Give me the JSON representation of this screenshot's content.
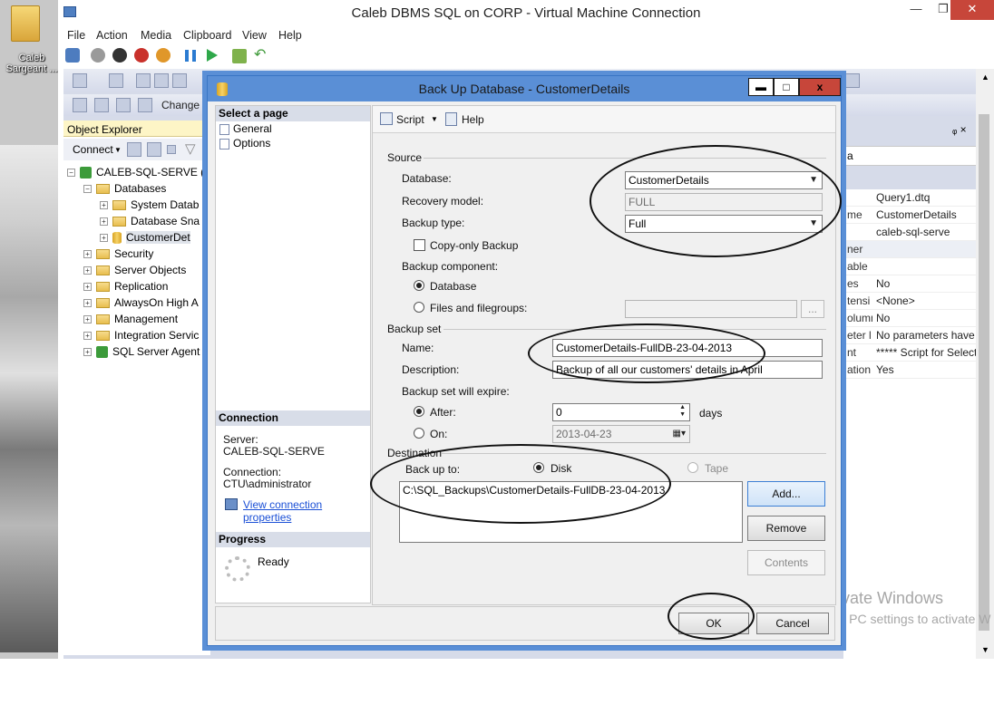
{
  "desktop": {
    "icon_label": "Caleb Sargeant ..."
  },
  "vm_window": {
    "title": "Caleb DBMS SQL on CORP - Virtual Machine Connection",
    "menu": [
      "File",
      "Action",
      "Media",
      "Clipboard",
      "View",
      "Help"
    ]
  },
  "ssms": {
    "change_label": "Change T",
    "object_explorer": {
      "title": "Object Explorer",
      "connect_label": "Connect",
      "tree": [
        {
          "label": "CALEB-SQL-SERVE (S",
          "level": 0,
          "icon": "server-icon",
          "expander": "−"
        },
        {
          "label": "Databases",
          "level": 1,
          "icon": "folder-icon",
          "expander": "−"
        },
        {
          "label": "System Datab",
          "level": 2,
          "icon": "folder-icon",
          "expander": "+"
        },
        {
          "label": "Database Sna",
          "level": 2,
          "icon": "folder-icon",
          "expander": "+"
        },
        {
          "label": "CustomerDet",
          "level": 2,
          "icon": "database-icon",
          "expander": "+"
        },
        {
          "label": "Security",
          "level": 1,
          "icon": "folder-icon",
          "expander": "+"
        },
        {
          "label": "Server Objects",
          "level": 1,
          "icon": "folder-icon",
          "expander": "+"
        },
        {
          "label": "Replication",
          "level": 1,
          "icon": "folder-icon",
          "expander": "+"
        },
        {
          "label": "AlwaysOn High A",
          "level": 1,
          "icon": "folder-icon",
          "expander": "+"
        },
        {
          "label": "Management",
          "level": 1,
          "icon": "folder-icon",
          "expander": "+"
        },
        {
          "label": "Integration Servic",
          "level": 1,
          "icon": "folder-icon",
          "expander": "+"
        },
        {
          "label": "SQL Server Agent",
          "level": 1,
          "icon": "agent-icon",
          "expander": "+"
        }
      ]
    },
    "properties": {
      "pane_pin": "ᵩ ×",
      "partial_label": "a",
      "rows": [
        {
          "k": "",
          "v": "Query1.dtq"
        },
        {
          "k": "me",
          "v": "CustomerDetails"
        },
        {
          "k": "",
          "v": "caleb-sql-serve"
        },
        {
          "k": "ner",
          "v": ""
        },
        {
          "k": "able",
          "v": ""
        },
        {
          "k": "es",
          "v": "No"
        },
        {
          "k": "tensi",
          "v": "<None>"
        },
        {
          "k": "olumn",
          "v": "No"
        },
        {
          "k": "eter l",
          "v": "No parameters have b"
        },
        {
          "k": "nt",
          "v": "***** Script for SelectT"
        },
        {
          "k": "ation",
          "v": "Yes"
        }
      ]
    },
    "watermark_title": "Activate Windows",
    "watermark_sub": "Go to PC settings to activate W"
  },
  "dialog": {
    "title": "Back Up Database - CustomerDetails",
    "title_buttons": {
      "minimize": "▬",
      "maximize": "□",
      "close": "x"
    },
    "select_page_header": "Select a page",
    "pages": [
      "General",
      "Options"
    ],
    "connection_header": "Connection",
    "server_label": "Server:",
    "server_value": "CALEB-SQL-SERVE",
    "connection_label": "Connection:",
    "connection_value": "CTU\\administrator",
    "view_connection_link": "View connection properties",
    "progress_header": "Progress",
    "progress_status": "Ready",
    "toolbar": {
      "script": "Script",
      "help": "Help"
    },
    "source": {
      "group": "Source",
      "database_label": "Database:",
      "database_value": "CustomerDetails",
      "recovery_label": "Recovery model:",
      "recovery_value": "FULL",
      "backup_type_label": "Backup type:",
      "backup_type_value": "Full",
      "copy_only_label": "Copy-only Backup",
      "component_label": "Backup component:",
      "component_database": "Database",
      "component_files": "Files and filegroups:",
      "files_browse": "..."
    },
    "backup_set": {
      "group": "Backup set",
      "name_label": "Name:",
      "name_value": "CustomerDetails-FullDB-23-04-2013",
      "description_label": "Description:",
      "description_value": "Backup of all our customers' details in April",
      "expire_label": "Backup set will expire:",
      "after_label": "After:",
      "after_value": "0",
      "days_label": "days",
      "on_label": "On:",
      "on_value": "2013-04-23"
    },
    "destination": {
      "group": "Destination",
      "backup_to_label": "Back up to:",
      "disk_label": "Disk",
      "tape_label": "Tape",
      "paths": [
        "C:\\SQL_Backups\\CustomerDetails-FullDB-23-04-2013"
      ],
      "add_button": "Add...",
      "remove_button": "Remove",
      "contents_button": "Contents"
    },
    "ok_button": "OK",
    "cancel_button": "Cancel"
  }
}
